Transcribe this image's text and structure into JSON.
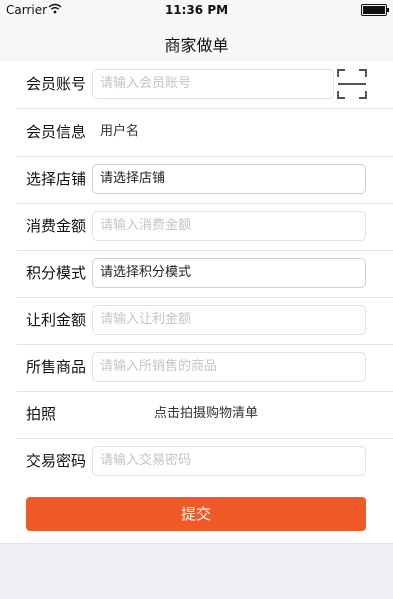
{
  "status_bar": {
    "carrier": "Carrier",
    "time": "11:36 PM"
  },
  "nav": {
    "title": "商家做单"
  },
  "form": {
    "member_account": {
      "label": "会员账号",
      "placeholder": "请输入会员账号"
    },
    "member_info": {
      "label": "会员信息",
      "value": "用户名"
    },
    "store": {
      "label": "选择店铺",
      "value": "请选择店铺"
    },
    "amount": {
      "label": "消费金额",
      "placeholder": "请输入消费金额"
    },
    "points_mode": {
      "label": "积分模式",
      "value": "请选择积分模式"
    },
    "discount": {
      "label": "让利金额",
      "placeholder": "请输入让利金额"
    },
    "goods": {
      "label": "所售商品",
      "placeholder": "请输入所销售的商品"
    },
    "photo": {
      "label": "拍照",
      "action": "点击拍摄购物清单"
    },
    "password": {
      "label": "交易密码",
      "placeholder": "请输入交易密码"
    }
  },
  "submit_label": "提交",
  "colors": {
    "accent": "#f05a28",
    "background": "#efeff4"
  },
  "icons": {
    "scan": "scan-icon",
    "wifi": "wifi-icon",
    "battery": "battery-icon"
  }
}
